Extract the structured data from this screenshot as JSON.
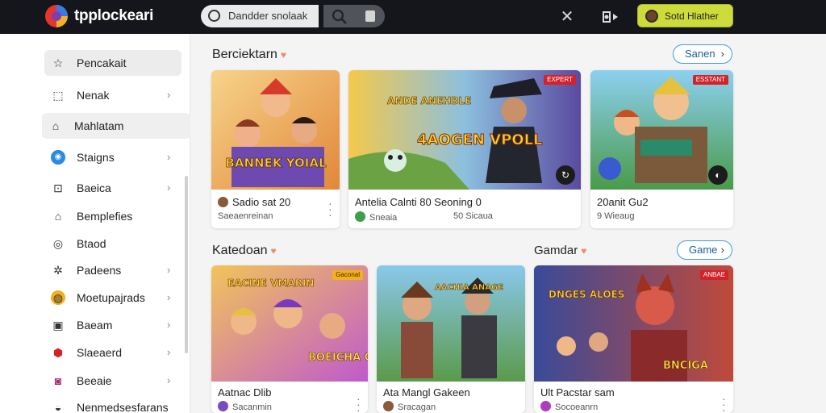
{
  "app": {
    "brand": "tpplockeari",
    "search_placeholder": "Dandder snolaak",
    "user_label": "Sotd Hlather"
  },
  "sidebar": {
    "items": [
      {
        "label": "Pencakait",
        "icon": "puzzle-icon",
        "glyph": "☆",
        "chevron": false
      },
      {
        "label": "Nenak",
        "icon": "crop-icon",
        "glyph": "⬚",
        "chevron": true
      },
      {
        "label": "Mahlatam",
        "icon": "home-icon",
        "glyph": "⌂",
        "chevron": false
      },
      {
        "label": "Staigns",
        "icon": "controller-icon",
        "glyph": "◉",
        "chevron": true
      },
      {
        "label": "Baeica",
        "icon": "gift-icon",
        "glyph": "⊡",
        "chevron": true
      },
      {
        "label": "Bemplefies",
        "icon": "house-icon",
        "glyph": "⌂",
        "chevron": false
      },
      {
        "label": "Btaod",
        "icon": "location-icon",
        "glyph": "◎",
        "chevron": false
      },
      {
        "label": "Padeens",
        "icon": "gear-icon",
        "glyph": "✲",
        "chevron": true
      },
      {
        "label": "Moetupajrads",
        "icon": "coin-icon",
        "glyph": "◍",
        "chevron": true
      },
      {
        "label": "Baeam",
        "icon": "box-icon",
        "glyph": "▣",
        "chevron": true
      },
      {
        "label": "Slaeaerd",
        "icon": "shield-icon",
        "glyph": "⬢",
        "chevron": true
      },
      {
        "label": "Beeaie",
        "icon": "token-icon",
        "glyph": "◙",
        "chevron": true
      },
      {
        "label": "Nenmedsesfarans",
        "icon": "burger-icon",
        "glyph": "◒",
        "chevron": false
      }
    ]
  },
  "section1": {
    "title": "Berciektarn",
    "pill": "Sanen",
    "cards": [
      {
        "title": "Sadio sat 20",
        "sub": "Saeaenreinan",
        "tag": ""
      },
      {
        "title": "Antelia Calnti 80 Seoning 0",
        "sub": "Sneaia",
        "sub2": "50 Sicaua",
        "tag": "EXPERT"
      },
      {
        "title": "20anit Gu2",
        "sub": "9 Wieaug",
        "tag": "ESSTANT"
      }
    ],
    "thumb_texts": [
      "BANNEK YOIAL",
      "ANDE ANEHBLE",
      "4AOGEN VPOLL",
      ""
    ]
  },
  "section2": {
    "title": "Katedoan",
    "title_right": "Gamdar",
    "pill": "Game",
    "cards": [
      {
        "title": "Aatnac Dlib",
        "sub": "Sacanmin",
        "tag": "Gaconal"
      },
      {
        "title": "Ata Mangl Gakeen",
        "sub": "Sracagan",
        "tag": ""
      },
      {
        "title": "Ult Pacstar sam",
        "sub": "Socoeanrn",
        "tag": "ANBAE"
      }
    ],
    "thumb_texts": [
      "EACINE VMARIN",
      "BOEICHA CAL",
      "AACHIA ANAGE",
      "DNGES ALOES",
      "BNCIGA"
    ]
  },
  "colors": {
    "topbar": "#14161b",
    "accent_user": "#cddc3a",
    "pill_border": "#3b9de0"
  }
}
